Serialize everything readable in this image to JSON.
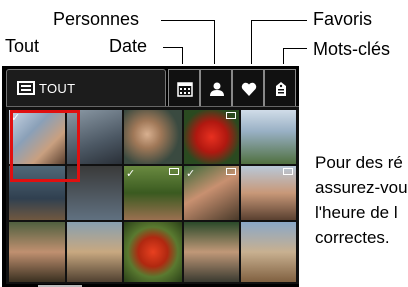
{
  "callouts": {
    "personnes": "Personnes",
    "favoris": "Favoris",
    "date": "Date",
    "mots_cles": "Mots-clés",
    "tout": "Tout"
  },
  "camera_ui": {
    "active_tab_label": "TOUT",
    "tabs": [
      {
        "name": "date",
        "icon": "calendar-icon"
      },
      {
        "name": "personnes",
        "icon": "person-icon"
      },
      {
        "name": "favoris",
        "icon": "heart-icon"
      },
      {
        "name": "mots_cles",
        "icon": "tag-icon"
      }
    ]
  },
  "info_text": {
    "line1": "Pour des ré",
    "line2": "assurez-vou",
    "line3": "l'heure de l",
    "line4": "correctes."
  },
  "colors": {
    "selection": "#e01010",
    "ui_background": "#000000"
  }
}
